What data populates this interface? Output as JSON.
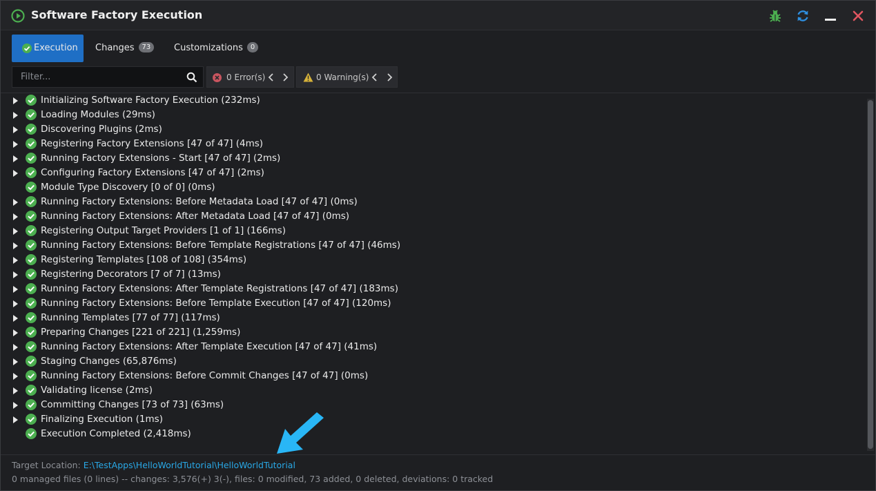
{
  "window": {
    "title": "Software Factory Execution"
  },
  "tabs": [
    {
      "label": "Execution",
      "badge": null
    },
    {
      "label": "Changes",
      "badge": "73"
    },
    {
      "label": "Customizations",
      "badge": "0"
    }
  ],
  "toolbar": {
    "filter_placeholder": "Filter...",
    "errors_label": "0 Error(s)",
    "warnings_label": "0 Warning(s)"
  },
  "steps": [
    {
      "label": "Initializing Software Factory Execution (232ms)",
      "expandable": true
    },
    {
      "label": "Loading Modules (29ms)",
      "expandable": true
    },
    {
      "label": "Discovering Plugins (2ms)",
      "expandable": true
    },
    {
      "label": "Registering Factory Extensions [47 of 47] (4ms)",
      "expandable": true
    },
    {
      "label": "Running Factory Extensions - Start [47 of 47] (2ms)",
      "expandable": true
    },
    {
      "label": "Configuring Factory Extensions [47 of 47] (2ms)",
      "expandable": true
    },
    {
      "label": "Module Type Discovery [0 of 0] (0ms)",
      "expandable": false
    },
    {
      "label": "Running Factory Extensions: Before Metadata Load [47 of 47] (0ms)",
      "expandable": true
    },
    {
      "label": "Running Factory Extensions: After Metadata Load [47 of 47] (0ms)",
      "expandable": true
    },
    {
      "label": "Registering Output Target Providers [1 of 1] (166ms)",
      "expandable": true
    },
    {
      "label": "Running Factory Extensions: Before Template Registrations [47 of 47] (46ms)",
      "expandable": true
    },
    {
      "label": "Registering Templates [108 of 108] (354ms)",
      "expandable": true
    },
    {
      "label": "Registering Decorators [7 of 7] (13ms)",
      "expandable": true
    },
    {
      "label": "Running Factory Extensions: After Template Registrations [47 of 47] (183ms)",
      "expandable": true
    },
    {
      "label": "Running Factory Extensions: Before Template Execution [47 of 47] (120ms)",
      "expandable": true
    },
    {
      "label": "Running Templates [77 of 77] (117ms)",
      "expandable": true
    },
    {
      "label": "Preparing Changes [221 of 221] (1,259ms)",
      "expandable": true
    },
    {
      "label": "Running Factory Extensions: After Template Execution [47 of 47] (41ms)",
      "expandable": true
    },
    {
      "label": "Staging Changes (65,876ms)",
      "expandable": true
    },
    {
      "label": "Running Factory Extensions: Before Commit Changes [47 of 47] (0ms)",
      "expandable": true
    },
    {
      "label": "Validating license (2ms)",
      "expandable": true
    },
    {
      "label": "Committing Changes [73 of 73] (63ms)",
      "expandable": true
    },
    {
      "label": "Finalizing Execution (1ms)",
      "expandable": true
    },
    {
      "label": "Execution Completed (2,418ms)",
      "expandable": false
    }
  ],
  "footer": {
    "target_label": "Target Location:",
    "target_path": "E:\\TestApps\\HelloWorldTutorial\\HelloWorldTutorial",
    "stats": "0 managed files (0 lines) -- changes: 3,576(+) 3(-), files: 0 modified, 73 added, 0 deleted, deviations: 0 tracked"
  },
  "colors": {
    "accent": "#1f6fc5",
    "success": "#4caf50",
    "link": "#29a8e6",
    "annotation_arrow": "#29b6f6"
  }
}
